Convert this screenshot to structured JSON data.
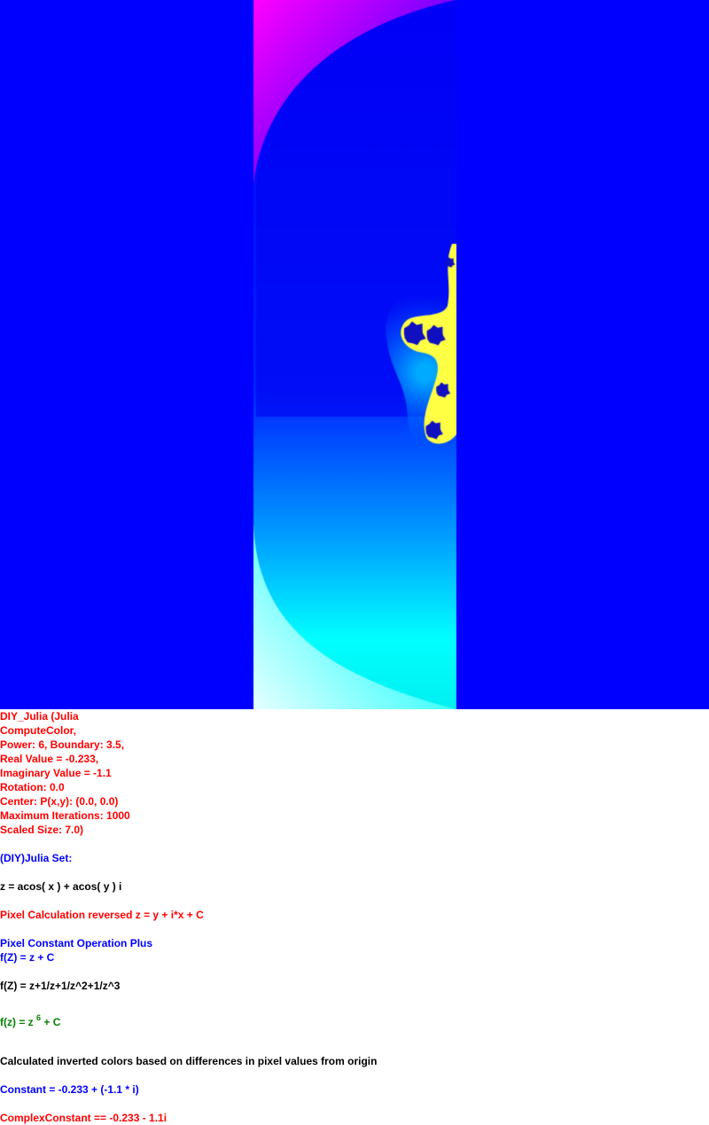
{
  "image": {
    "description_icon": "fractal-image",
    "colors": {
      "background": "#0000ff",
      "magenta": "#ff00ff",
      "cyan": "#00ffff",
      "pale_cyan": "#e6ffff",
      "yellow": "#ffff44"
    }
  },
  "params": {
    "line1": "DIY_Julia (Julia",
    "line2": "ComputeColor,",
    "line3": "Power: 6, Boundary: 3.5,",
    "line4": "Real Value = -0.233,",
    "line5": "Imaginary Value = -1.1",
    "line6": "Rotation: 0.0",
    "line7": "Center: P(x,y): (0.0, 0.0)",
    "line8": "Maximum Iterations: 1000",
    "line9": "Scaled Size: 7.0)"
  },
  "notes": {
    "set_name": "(DIY)Julia Set:",
    "z_def": "z = acos( x ) + acos( y ) i",
    "pixel_calc": "Pixel Calculation reversed z = y + i*x + C",
    "pixel_const_op": "Pixel Constant Operation Plus",
    "fz_plus": "f(Z) = z + C",
    "fz_series": "f(Z) = z+1/z+1/z^2+1/z^3",
    "fz_power_prefix": "f(z) = z ",
    "fz_power_exp": "6",
    "fz_power_suffix": " + C",
    "inverted": "Calculated inverted colors based on differences in pixel values from origin",
    "constant": "Constant = -0.233 + (-1.1 * i)",
    "complex_constant": "ComplexConstant == -0.233 - 1.1i"
  }
}
